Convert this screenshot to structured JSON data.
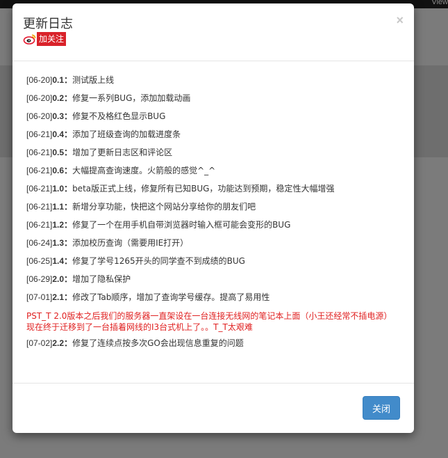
{
  "background": {
    "topbar_text": "View"
  },
  "modal": {
    "title": "更新日志",
    "close_symbol": "×",
    "follow_label": "加关注",
    "footer_close_label": "关闭"
  },
  "changelog": [
    {
      "date": "[06-20]",
      "version": "0.1",
      "sep": "：",
      "text": "测试版上线"
    },
    {
      "date": "[06-20]",
      "version": "0.2",
      "sep": "：",
      "text": "修复一系列BUG，添加加载动画"
    },
    {
      "date": "[06-20]",
      "version": "0.3",
      "sep": "：",
      "text": "修复不及格红色显示BUG"
    },
    {
      "date": "[06-21]",
      "version": "0.4",
      "sep": "：",
      "text": "添加了班级查询的加载进度条"
    },
    {
      "date": "[06-21]",
      "version": "0.5",
      "sep": "：",
      "text": "增加了更新日志区和评论区"
    },
    {
      "date": "[06-21]",
      "version": "0.6",
      "sep": "：",
      "text": "大幅提高查询速度。火箭般的感觉^_^"
    },
    {
      "date": "[06-21]",
      "version": "1.0",
      "sep": "：",
      "text": "beta版正式上线，修复所有已知BUG，功能达到预期，稳定性大幅增强"
    },
    {
      "date": "[06-21]",
      "version": "1.1",
      "sep": "：",
      "text": "新增分享功能，快把这个网站分享给你的朋友们吧"
    },
    {
      "date": "[06-21]",
      "version": "1.2",
      "sep": "：",
      "text": "修复了一个在用手机自带浏览器时输入框可能会变形的BUG"
    },
    {
      "date": "[06-24]",
      "version": "1.3",
      "sep": "：",
      "text": "添加校历查询（需要用IE打开）"
    },
    {
      "date": "[06-25]",
      "version": "1.4",
      "sep": "：",
      "text": "修复了学号1265开头的同学查不到成绩的BUG"
    },
    {
      "date": "[06-29]",
      "version": "2.0",
      "sep": "：",
      "text": "增加了隐私保护"
    },
    {
      "date": "[07-01]",
      "version": "2.1",
      "sep": "：",
      "text": "修改了Tab顺序，增加了查询学号缓存。提高了易用性"
    }
  ],
  "notice": {
    "line1": "PST_T 2.0版本之后我们的服务器一直架设在一台连接无线网的笔记本上面（小王还经常不插电源）",
    "line2": "现在终于迁移到了一台插着网线的I3台式机上了。。T_T太艰难",
    "color": "#e02020"
  },
  "changelog_after": [
    {
      "date": "[07-02]",
      "version": "2.2",
      "sep": "：",
      "text": "修复了连续点按多次GO会出现信息重复的问题"
    }
  ]
}
